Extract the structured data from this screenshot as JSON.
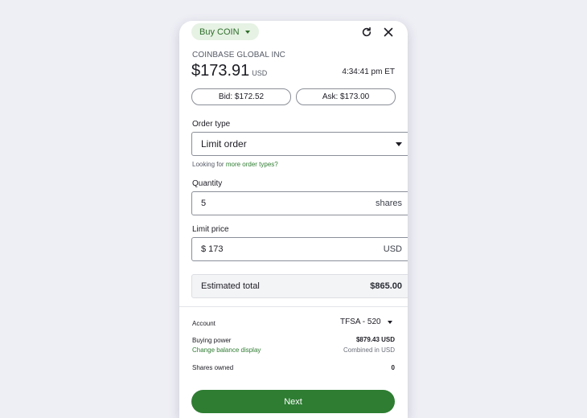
{
  "header": {
    "buy_label": "Buy COIN",
    "refresh_icon": "refresh-icon",
    "close_icon": "close-icon"
  },
  "security": {
    "name": "COINBASE GLOBAL INC",
    "price": "$173.91",
    "currency": "USD",
    "time": "4:34:41 pm ET"
  },
  "quotes": {
    "bid_label": "Bid: $172.52",
    "ask_label": "Ask: $173.00"
  },
  "order": {
    "order_type_label": "Order type",
    "order_type_value": "Limit order",
    "more_prefix": "Looking for",
    "more_link": "more order types?",
    "quantity_label": "Quantity",
    "quantity_value": "5",
    "quantity_suffix": "shares",
    "limit_label": "Limit price",
    "limit_value": "$ 173",
    "limit_suffix": "USD",
    "estimated_label": "Estimated total",
    "estimated_value": "$865.00"
  },
  "account": {
    "account_label": "Account",
    "account_value": "TFSA - 520",
    "buying_power_label": "Buying power",
    "change_balance_link": "Change balance display",
    "buying_power_value": "$879.43 USD",
    "combined_note": "Combined in USD",
    "shares_owned_label": "Shares owned",
    "shares_owned_value": "0"
  },
  "actions": {
    "next_label": "Next"
  },
  "colors": {
    "accent_green": "#2e7d32",
    "pill_bg": "#e6f2e4",
    "page_bg": "#eeeef5"
  }
}
